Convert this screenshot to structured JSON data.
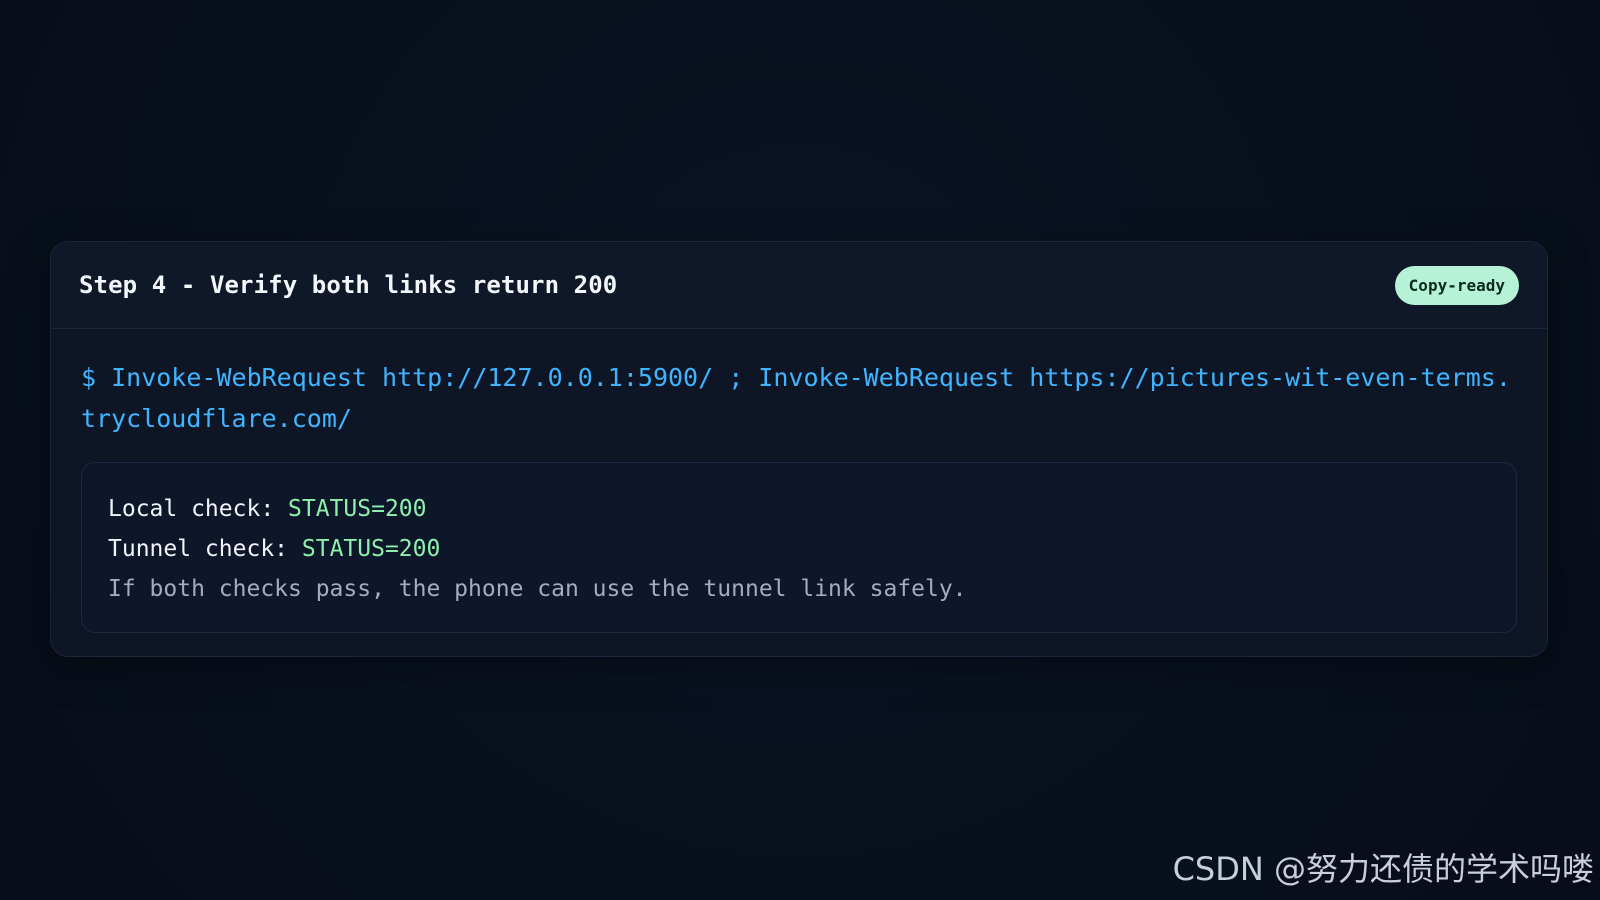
{
  "card": {
    "title": "Step 4 - Verify both links return 200",
    "badge": "Copy-ready",
    "command": "$ Invoke-WebRequest http://127.0.0.1:5900/ ; Invoke-WebRequest https://pictures-wit-even-terms.trycloudflare.com/",
    "output": {
      "local_label": "Local check: ",
      "local_status": "STATUS=200",
      "tunnel_label": "Tunnel check: ",
      "tunnel_status": "STATUS=200",
      "note": "If both checks pass, the phone can use the tunnel link safely."
    }
  },
  "watermark": "CSDN @努力还债的学术吗喽",
  "colors": {
    "background": "#08101d",
    "card": "#0e1626",
    "command": "#41b4ff",
    "status": "#8ef0ad",
    "badge": "#b6f3d6"
  }
}
